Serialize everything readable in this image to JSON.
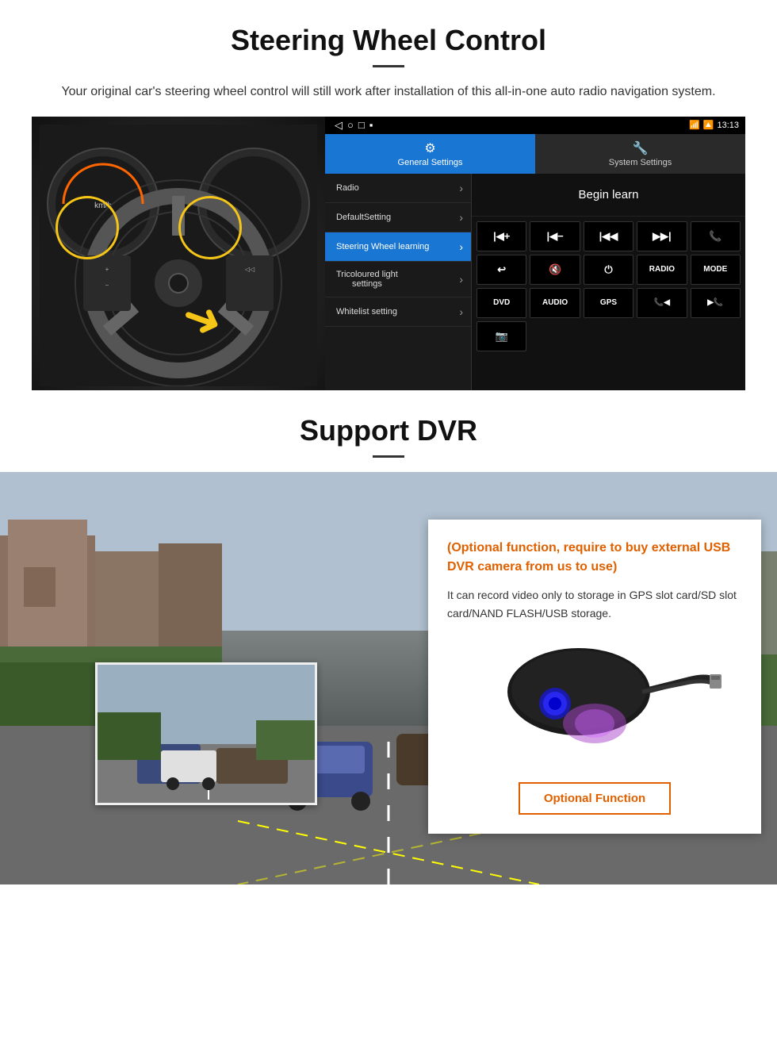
{
  "steering_section": {
    "title": "Steering Wheel Control",
    "subtitle": "Your original car's steering wheel control will still work after installation of this all-in-one auto radio navigation system.",
    "android_ui": {
      "status_bar": {
        "back_icon": "◁",
        "home_icon": "○",
        "square_icon": "□",
        "menu_icon": "▪",
        "signal_icon": "▼",
        "wifi_icon": "▾",
        "time": "13:13"
      },
      "tab_general": "General Settings",
      "tab_system": "System Settings",
      "menu_items": [
        {
          "label": "Radio",
          "active": false
        },
        {
          "label": "DefaultSetting",
          "active": false
        },
        {
          "label": "Steering Wheel learning",
          "active": true
        },
        {
          "label": "Tricoloured light settings",
          "active": false
        },
        {
          "label": "Whitelist setting",
          "active": false
        }
      ],
      "begin_learn_label": "Begin learn",
      "buttons_row1": [
        "⏮+",
        "⏮−",
        "⏮⏮",
        "⏭⏭",
        "📞"
      ],
      "buttons_row2": [
        "↩",
        "🔇",
        "⏻",
        "RADIO",
        "MODE"
      ],
      "buttons_row3": [
        "DVD",
        "AUDIO",
        "GPS",
        "📞⏮",
        "⏭📞"
      ],
      "buttons_row4": [
        "📷"
      ]
    }
  },
  "dvr_section": {
    "title": "Support DVR",
    "optional_highlight": "(Optional function, require to buy external USB DVR camera from us to use)",
    "description": "It can record video only to storage in GPS slot card/SD slot card/NAND FLASH/USB storage.",
    "optional_function_btn": "Optional Function"
  }
}
